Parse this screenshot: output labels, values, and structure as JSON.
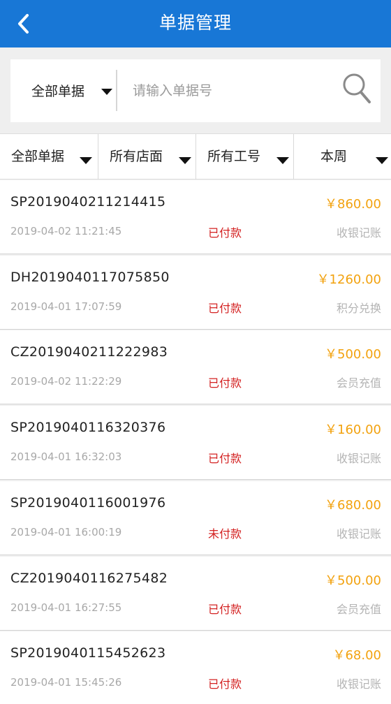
{
  "header": {
    "title": "单据管理"
  },
  "search": {
    "scope": "全部单据",
    "placeholder": "请输入单据号"
  },
  "filters": [
    {
      "label": "全部单据"
    },
    {
      "label": "所有店面"
    },
    {
      "label": "所有工号"
    },
    {
      "label": "本周"
    }
  ],
  "orders": [
    {
      "no": "SP2019040211214415",
      "amount": "￥860.00",
      "time": "2019-04-02 11:21:45",
      "status": "已付款",
      "type": "收银记账"
    },
    {
      "no": "DH2019040117075850",
      "amount": "￥1260.00",
      "time": "2019-04-01 17:07:59",
      "status": "已付款",
      "type": "积分兑换"
    },
    {
      "no": "CZ2019040211222983",
      "amount": "￥500.00",
      "time": "2019-04-02 11:22:29",
      "status": "已付款",
      "type": "会员充值"
    },
    {
      "no": "SP2019040116320376",
      "amount": "￥160.00",
      "time": "2019-04-01 16:32:03",
      "status": "已付款",
      "type": "收银记账"
    },
    {
      "no": "SP2019040116001976",
      "amount": "￥680.00",
      "time": "2019-04-01 16:00:19",
      "status": "未付款",
      "type": "收银记账"
    },
    {
      "no": "CZ2019040116275482",
      "amount": "￥500.00",
      "time": "2019-04-01 16:27:55",
      "status": "已付款",
      "type": "会员充值"
    },
    {
      "no": "SP2019040115452623",
      "amount": "￥68.00",
      "time": "2019-04-01 15:45:26",
      "status": "已付款",
      "type": "收银记账"
    }
  ],
  "colors": {
    "header": "#1877d6",
    "amount": "#f2a20f",
    "status": "#d32121"
  },
  "icons": {
    "back": "chevron-left-icon",
    "search": "search-icon"
  }
}
